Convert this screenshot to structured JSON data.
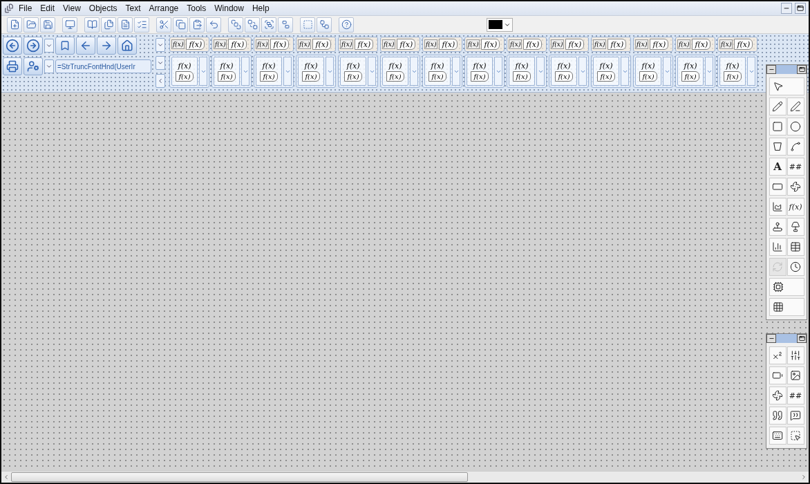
{
  "menu": [
    "File",
    "Edit",
    "View",
    "Objects",
    "Text",
    "Arrange",
    "Tools",
    "Window",
    "Help"
  ],
  "color_picker": {
    "color": "#000000"
  },
  "expression_field": {
    "value": "=StrTruncFontHnd(UserIr"
  },
  "formula_top": [
    {
      "small": "f(x)",
      "large": "f(x)"
    },
    {
      "small": "f(x)",
      "large": "f(x)"
    },
    {
      "small": "f(x)",
      "large": "f(x)"
    },
    {
      "small": "f(x)",
      "large": "f(x)"
    },
    {
      "small": "f(x)",
      "large": "f(x)"
    },
    {
      "small": "f(x)",
      "large": "f(x)"
    },
    {
      "small": "f(x)",
      "large": "f(x)"
    },
    {
      "small": "f(x)",
      "large": "f(x)"
    },
    {
      "small": "f(x)",
      "large": "f(x)"
    },
    {
      "small": "f(x)",
      "large": "f(x)"
    },
    {
      "small": "f(x)",
      "large": "f(x)"
    },
    {
      "small": "f(x)",
      "large": "f(x)"
    },
    {
      "small": "f(x)",
      "large": "f(x)"
    },
    {
      "small": "f(x)",
      "large": "f(x)"
    }
  ],
  "formula_bottom": [
    {
      "upper": "f(x)",
      "lower": "f(x)"
    },
    {
      "upper": "f(x)",
      "lower": "f(x)"
    },
    {
      "upper": "f(x)",
      "lower": "f(x)"
    },
    {
      "upper": "f(x)",
      "lower": "f(x)"
    },
    {
      "upper": "f(x)",
      "lower": "f(x)"
    },
    {
      "upper": "f(x)",
      "lower": "f(x)"
    },
    {
      "upper": "f(x)",
      "lower": "f(x)"
    },
    {
      "upper": "f(x)",
      "lower": "f(x)"
    },
    {
      "upper": "f(x)",
      "lower": "f(x)"
    },
    {
      "upper": "f(x)",
      "lower": "f(x)"
    },
    {
      "upper": "f(x)",
      "lower": "f(x)"
    },
    {
      "upper": "f(x)",
      "lower": "f(x)"
    },
    {
      "upper": "f(x)",
      "lower": "f(x)"
    },
    {
      "upper": "f(x)",
      "lower": "f(x)"
    }
  ],
  "palettes": [
    {
      "tools": [
        {
          "kind": "icon",
          "disabled": false
        },
        {
          "kind": "icon",
          "disabled": false
        },
        {
          "kind": "icon",
          "disabled": false
        },
        {
          "kind": "icon",
          "disabled": false
        },
        {
          "kind": "icon",
          "disabled": false
        },
        {
          "kind": "icon",
          "disabled": false
        },
        {
          "kind": "icon",
          "disabled": false
        },
        {
          "kind": "glyph",
          "text": "A",
          "disabled": false
        },
        {
          "kind": "glyph",
          "text": "##",
          "disabled": false
        },
        {
          "kind": "icon",
          "disabled": false
        },
        {
          "kind": "icon",
          "disabled": false
        },
        {
          "kind": "icon",
          "disabled": false
        },
        {
          "kind": "glyph",
          "text": "f(x)",
          "disabled": false
        },
        {
          "kind": "icon",
          "disabled": false
        },
        {
          "kind": "icon",
          "disabled": false
        },
        {
          "kind": "icon",
          "disabled": false
        },
        {
          "kind": "icon",
          "disabled": false
        },
        {
          "kind": "icon",
          "disabled": true
        },
        {
          "kind": "icon",
          "disabled": false
        },
        {
          "kind": "icon",
          "disabled": false
        },
        {
          "kind": "icon",
          "disabled": false
        }
      ]
    },
    {
      "tools": [
        {
          "kind": "icon",
          "disabled": false
        },
        {
          "kind": "icon",
          "disabled": false
        },
        {
          "kind": "icon",
          "disabled": false
        },
        {
          "kind": "icon",
          "disabled": false
        },
        {
          "kind": "icon",
          "disabled": false
        },
        {
          "kind": "glyph",
          "text": "##",
          "disabled": false
        },
        {
          "kind": "icon",
          "disabled": false
        },
        {
          "kind": "icon",
          "disabled": false
        },
        {
          "kind": "icon",
          "disabled": false
        },
        {
          "kind": "icon",
          "disabled": false
        }
      ]
    }
  ]
}
